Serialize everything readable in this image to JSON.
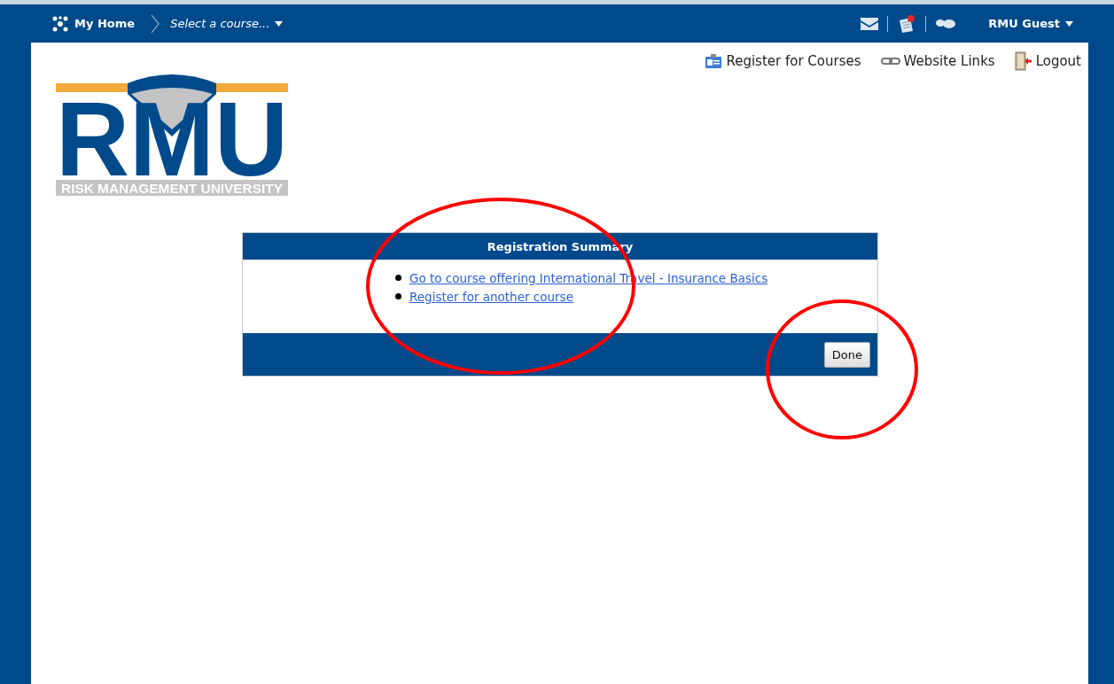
{
  "top_bar": {
    "home": "My Home",
    "course_select": "Select a course...",
    "user": "RMU Guest",
    "notifications": {
      "has_alert": true
    }
  },
  "header_links": [
    {
      "kind": "register",
      "label": "Register for Courses"
    },
    {
      "kind": "links",
      "label": "Website Links"
    },
    {
      "kind": "logout",
      "label": "Logout"
    }
  ],
  "logo": {
    "letters": "RMU",
    "tagline": "RISK MANAGEMENT UNIVERSITY"
  },
  "panel": {
    "title": "Registration Summary",
    "links": [
      "Go to course offering International Travel - Insurance Basics",
      "Register for another course"
    ],
    "button": "Done"
  },
  "annotations": [
    {
      "kind": "circle"
    },
    {
      "kind": "circle"
    }
  ]
}
